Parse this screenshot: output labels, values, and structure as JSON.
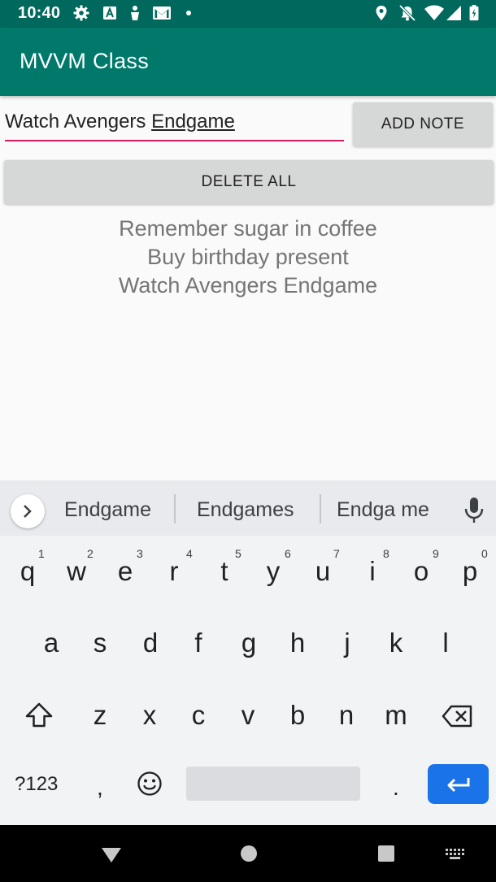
{
  "status_bar": {
    "time": "10:40",
    "left_icons": [
      "gear-icon",
      "text-a-icon",
      "person-icon",
      "gmail-icon",
      "dot-icon"
    ],
    "right_icons": [
      "location-icon",
      "dnd-icon",
      "wifi-icon",
      "signal-icon",
      "battery-icon"
    ]
  },
  "app_bar": {
    "title": "MVVM Class"
  },
  "note_input": {
    "value_plain": "Watch Avengers ",
    "value_composing": "Endgame"
  },
  "buttons": {
    "add_note": "ADD NOTE",
    "delete_all": "DELETE ALL"
  },
  "notes": [
    "Remember sugar in coffee",
    "Buy birthday present",
    "Watch Avengers Endgame"
  ],
  "keyboard": {
    "suggestions": [
      "Endgame",
      "Endgames",
      "Endga me"
    ],
    "row1": [
      "q",
      "w",
      "e",
      "r",
      "t",
      "y",
      "u",
      "i",
      "o",
      "p"
    ],
    "row1_hints": [
      "1",
      "2",
      "3",
      "4",
      "5",
      "6",
      "7",
      "8",
      "9",
      "0"
    ],
    "row2": [
      "a",
      "s",
      "d",
      "f",
      "g",
      "h",
      "j",
      "k",
      "l"
    ],
    "row3": [
      "z",
      "x",
      "c",
      "v",
      "b",
      "n",
      "m"
    ],
    "symbols_key": "?123",
    "comma_key": ",",
    "period_key": "."
  },
  "colors": {
    "primary": "#00796b",
    "primary_dark": "#00685c",
    "accent": "#d81b60",
    "enter_key": "#1a73e8"
  }
}
